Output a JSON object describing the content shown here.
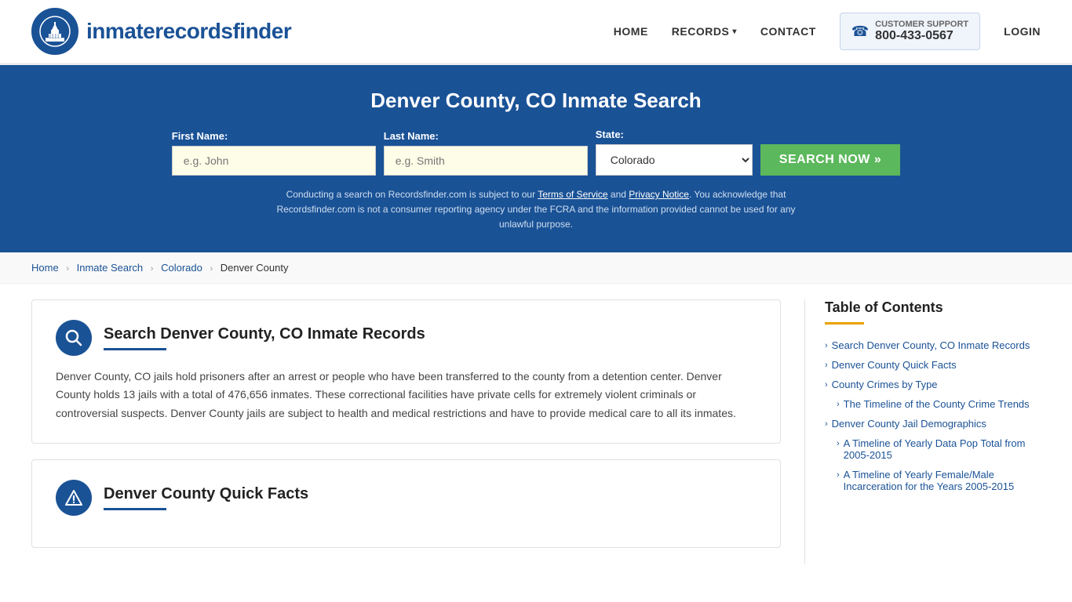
{
  "header": {
    "logo_text_regular": "inmaterecords",
    "logo_text_bold": "finder",
    "nav": {
      "home": "HOME",
      "records": "RECORDS",
      "contact": "CONTACT",
      "login": "LOGIN"
    },
    "support": {
      "label": "CUSTOMER SUPPORT",
      "phone": "800-433-0567"
    }
  },
  "hero": {
    "title": "Denver County, CO Inmate Search",
    "first_name_label": "First Name:",
    "first_name_placeholder": "e.g. John",
    "last_name_label": "Last Name:",
    "last_name_placeholder": "e.g. Smith",
    "state_label": "State:",
    "state_value": "Colorado",
    "search_button": "SEARCH NOW »",
    "disclaimer": "Conducting a search on Recordsfinder.com is subject to our Terms of Service and Privacy Notice. You acknowledge that Recordsfinder.com is not a consumer reporting agency under the FCRA and the information provided cannot be used for any unlawful purpose."
  },
  "breadcrumb": {
    "home": "Home",
    "inmate_search": "Inmate Search",
    "state": "Colorado",
    "county": "Denver County"
  },
  "main_section": {
    "title": "Search Denver County, CO Inmate Records",
    "body": "Denver County, CO jails hold prisoners after an arrest or people who have been transferred to the county from a detention center. Denver County holds 13 jails with a total of 476,656 inmates. These correctional facilities have private cells for extremely violent criminals or controversial suspects. Denver County jails are subject to health and medical restrictions and have to provide medical care to all its inmates."
  },
  "quick_facts_section": {
    "title": "Denver County Quick Facts"
  },
  "toc": {
    "title": "Table of Contents",
    "items": [
      {
        "label": "Search Denver County, CO Inmate Records",
        "sub": false
      },
      {
        "label": "Denver County Quick Facts",
        "sub": false
      },
      {
        "label": "County Crimes by Type",
        "sub": false
      },
      {
        "label": "The Timeline of the County Crime Trends",
        "sub": true
      },
      {
        "label": "Denver County Jail Demographics",
        "sub": false
      },
      {
        "label": "A Timeline of Yearly Data Pop Total from 2005-2015",
        "sub": true
      },
      {
        "label": "A Timeline of Yearly Female/Male Incarceration for the Years 2005-2015",
        "sub": true
      }
    ]
  }
}
